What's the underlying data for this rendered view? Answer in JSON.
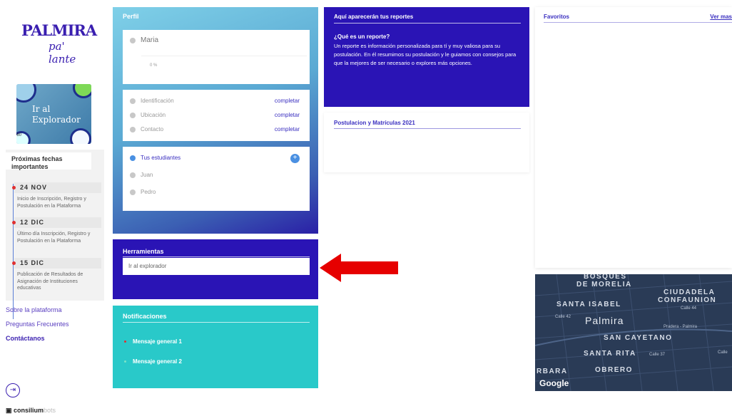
{
  "sidebar": {
    "logo_line1": "PALMIRA",
    "logo_line2": "pa' lante",
    "explorer_card": "Ir al Explorador",
    "badge_360": "360",
    "dates_title": "Próximas fechas importantes",
    "dates": [
      {
        "date": "24 NOV",
        "desc": "Inicio de Inscripción, Registro y Postulación en la Plataforma"
      },
      {
        "date": "12 DIC",
        "desc": "Último día Inscripción, Registro y Postulación en la Plataforma"
      },
      {
        "date": "15 DIC",
        "desc": "Publicación de Resultados de Asignación de Instituciones educativas"
      }
    ],
    "links": [
      "Sobre la plataforma",
      "Preguntas Frecuentes",
      "Contáctanos"
    ],
    "brand": "consilium",
    "brand_suffix": "bots"
  },
  "perfil": {
    "title": "Perfil",
    "name": "Maria",
    "progress": "0 %",
    "fields": [
      {
        "label": "Identificación",
        "action": "completar"
      },
      {
        "label": "Ubicación",
        "action": "completar"
      },
      {
        "label": "Contacto",
        "action": "completar"
      }
    ],
    "students_label": "Tus estudiantes",
    "add_label": "+",
    "students": [
      "Juan",
      "Pedro"
    ]
  },
  "herramientas": {
    "title": "Herramientas",
    "items": [
      "Ir al explorador"
    ]
  },
  "notificaciones": {
    "title": "Notificaciones",
    "messages": [
      {
        "text": "Mensaje general 1",
        "dot_color": "#e03030"
      },
      {
        "text": "Mensaje general 2",
        "dot_color": "#7be3c8"
      }
    ]
  },
  "reportes": {
    "title": "Aquí aparecerán tus reportes",
    "question": "¿Qué es un reporte?",
    "body": "Un reporte es información personalizada para tí y muy valiosa para su postulación. En él resumimos su postulación y le guiamos con consejos para que la mejores de ser necesario o explores más opciones."
  },
  "postulacion": {
    "title": "Postulacion y Matrículas 2021"
  },
  "favoritos": {
    "title": "Favoritos",
    "more_link": "Ver mas"
  },
  "map": {
    "labels": [
      "BOSQUES",
      "DE MORELIA",
      "CIUDADELA",
      "CONFAUNION",
      "SANTA ISABEL",
      "SAN CAYETANO",
      "SANTA RITA",
      "OBRERO",
      "RBARA"
    ],
    "city": "Palmira",
    "streets": [
      "Calle 42",
      "Calle 44",
      "Calle 37",
      "Pradera - Palmira",
      "Calle"
    ],
    "attribution": "Google"
  },
  "colors": {
    "primary": "#2a14b5",
    "accent_teal": "#29c9c9",
    "link": "#3a2fc0",
    "arrow": "#e60000"
  }
}
